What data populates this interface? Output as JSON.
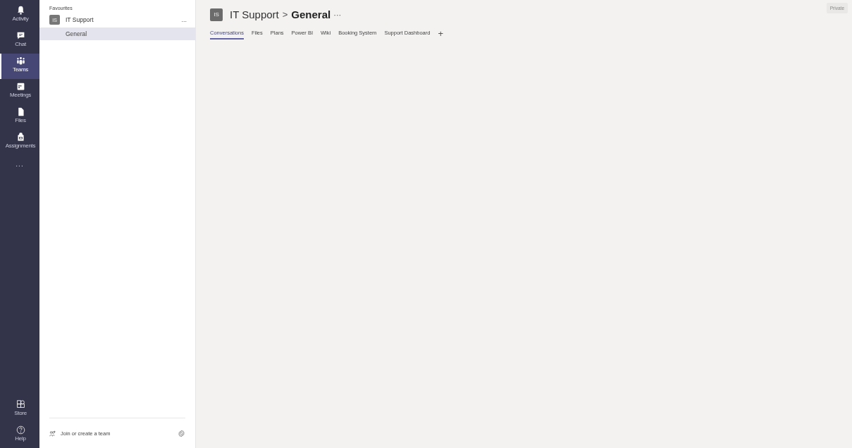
{
  "rail": {
    "items": [
      {
        "label": "Activity",
        "selected": false
      },
      {
        "label": "Chat",
        "selected": false
      },
      {
        "label": "Teams",
        "selected": true
      },
      {
        "label": "Meetings",
        "selected": false
      },
      {
        "label": "Files",
        "selected": false
      },
      {
        "label": "Assignments",
        "selected": false
      }
    ],
    "more": "...",
    "bottom_items": [
      {
        "label": "Store",
        "selected": false
      },
      {
        "label": "Help",
        "selected": false
      }
    ]
  },
  "sidebar": {
    "section": "Favourites",
    "team": {
      "initials": "IS",
      "name": "IT Support",
      "more": "...",
      "channels": [
        {
          "name": "General",
          "selected": true
        }
      ]
    },
    "join": "Join or create a team"
  },
  "header": {
    "initials": "IS",
    "team": "IT Support",
    "separator": ">",
    "channel": "General",
    "more": "···",
    "badge": "Private"
  },
  "tabs": [
    {
      "label": "Conversations",
      "selected": true
    },
    {
      "label": "Files",
      "selected": false
    },
    {
      "label": "Plans",
      "selected": false
    },
    {
      "label": "Power BI",
      "selected": false
    },
    {
      "label": "Wiki",
      "selected": false
    },
    {
      "label": "Booking System",
      "selected": false
    },
    {
      "label": "Support Dashboard",
      "selected": false
    }
  ],
  "add_tab": "+"
}
